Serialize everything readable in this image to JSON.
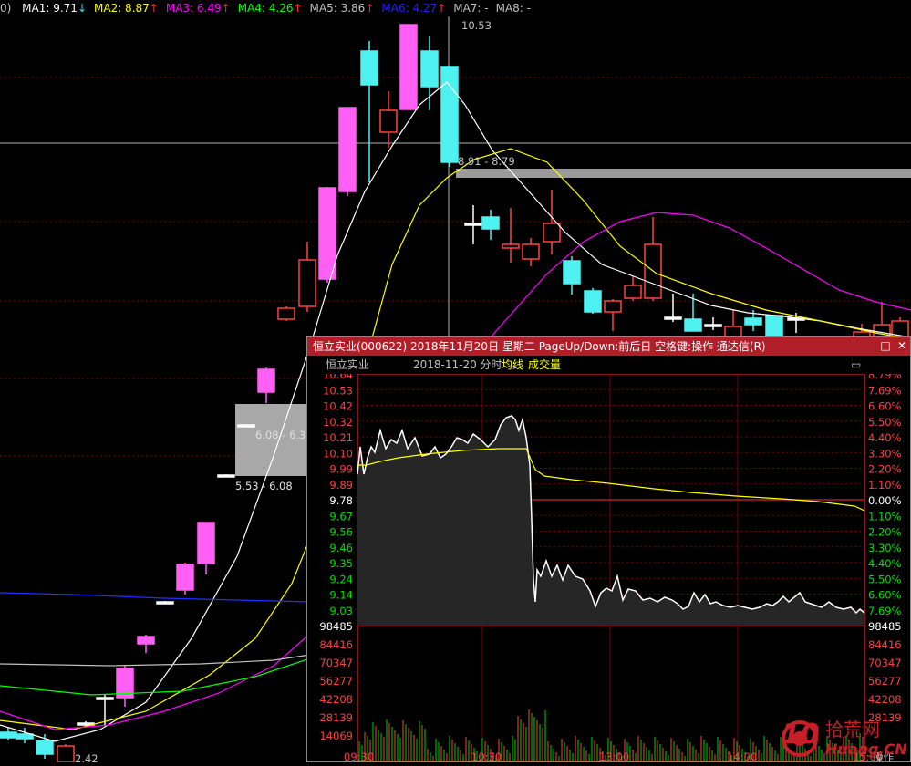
{
  "ma_bar": {
    "prefix": "0)",
    "items": [
      {
        "text": "MA1: 9.71",
        "arrow": "↓",
        "color": "#ffffff"
      },
      {
        "text": "MA2: 8.87",
        "arrow": "↑",
        "color": "#ffff00"
      },
      {
        "text": "MA3: 6.49",
        "arrow": "↑",
        "color": "#ff00ff"
      },
      {
        "text": "MA4: 4.26",
        "arrow": "↑",
        "color": "#00ff00"
      },
      {
        "text": "MA5: 3.86",
        "arrow": "↑",
        "color": "#c0c0c0"
      },
      {
        "text": "MA6: 4.27",
        "arrow": "↑",
        "color": "#2020ff"
      },
      {
        "text": "MA7: -",
        "arrow": "",
        "color": "#c0c0c0"
      },
      {
        "text": "MA8: -",
        "arrow": "",
        "color": "#c0c0c0"
      }
    ]
  },
  "kline": {
    "high_label": "10.53",
    "cursor_range": "8.91 - 8.79",
    "gap_label_1": "6.08 - 6.3",
    "gap_label_2": "5.53 - 6.08",
    "low_label": "2.42"
  },
  "popup": {
    "title": "恒立实业(000622) 2018年11月20日 星期二 PageUp/Down:前后日 空格键:操作 通达信(R)",
    "maximize_icon": "□",
    "close_icon": "✕",
    "sub_name": "恒立实业",
    "sub_date": "2018-11-20 分时",
    "sub_avg": "均线",
    "sub_vol": "成交量",
    "collapse_icon": "▭",
    "price_labels": [
      "10.64",
      "10.53",
      "10.42",
      "10.32",
      "10.21",
      "10.10",
      "9.99",
      "9.89",
      "9.78",
      "9.67",
      "9.56",
      "9.46",
      "9.35",
      "9.24",
      "9.14",
      "9.03"
    ],
    "pct_labels": [
      "8.79%",
      "7.69%",
      "6.60%",
      "5.50%",
      "4.40%",
      "3.30%",
      "2.20%",
      "1.10%",
      "0.00%",
      "1.10%",
      "2.20%",
      "3.30%",
      "4.40%",
      "5.50%",
      "6.60%",
      "7.69%"
    ],
    "vol_labels_left": [
      "98485",
      "84416",
      "70347",
      "56277",
      "42208",
      "28139",
      "14069"
    ],
    "vol_labels_right": [
      "98485",
      "84416",
      "70347",
      "56277",
      "42208",
      "28139"
    ],
    "time_labels": [
      "09:30",
      "10:30",
      "13:00",
      "14:00",
      "15:00"
    ],
    "op_label": "操作"
  },
  "watermark": {
    "num": "10",
    "top": "拾荒网",
    "bottom": "Huang.CN"
  },
  "colors": {
    "up": "#ff4040",
    "down": "#4ff0f0",
    "pink": "#ff5ff5",
    "grid": "#7a0000",
    "title_bar": "#b01e28"
  }
}
